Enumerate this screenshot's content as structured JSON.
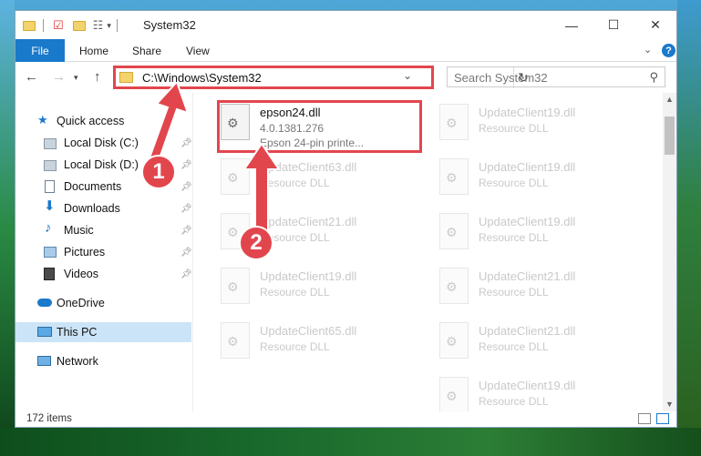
{
  "window": {
    "title": "System32",
    "controls": {
      "minimize": "—",
      "maximize": "☐",
      "close": "✕"
    }
  },
  "ribbon": {
    "tabs": [
      "File",
      "Home",
      "Share",
      "View"
    ],
    "help": "?"
  },
  "address": {
    "path": "C:\\Windows\\System32",
    "search_placeholder": "Search System32"
  },
  "sidebar": {
    "quick_access": "Quick access",
    "items": [
      {
        "label": "Local Disk (C:)",
        "icon": "drive-icon",
        "pinned": true
      },
      {
        "label": "Local Disk (D:)",
        "icon": "drive-icon",
        "pinned": true
      },
      {
        "label": "Documents",
        "icon": "documents-icon",
        "pinned": true
      },
      {
        "label": "Downloads",
        "icon": "downloads-icon",
        "pinned": true
      },
      {
        "label": "Music",
        "icon": "music-icon",
        "pinned": true
      },
      {
        "label": "Pictures",
        "icon": "pictures-icon",
        "pinned": true
      },
      {
        "label": "Videos",
        "icon": "videos-icon",
        "pinned": true
      }
    ],
    "onedrive": "OneDrive",
    "this_pc": "This PC",
    "network": "Network"
  },
  "files": [
    {
      "name": "epson24.dll",
      "version": "4.0.1381.276",
      "desc": "Epson 24-pin printe...",
      "highlight": true
    },
    {
      "name": "UpdateClient19.dll",
      "version": "Resource DLL",
      "desc": ""
    },
    {
      "name": "UpdateClient19.dll",
      "version": "Resource DLL",
      "desc": ""
    },
    {
      "name": "UpdateClient63.dll",
      "version": "Resource DLL",
      "desc": ""
    },
    {
      "name": "UpdateClient19.dll",
      "version": "Resource DLL",
      "desc": ""
    },
    {
      "name": "UpdateClient21.dll",
      "version": "Resource DLL",
      "desc": ""
    },
    {
      "name": "UpdateClient21.dll",
      "version": "Resource DLL",
      "desc": ""
    },
    {
      "name": "UpdateClient19.dll",
      "version": "Resource DLL",
      "desc": ""
    },
    {
      "name": "UpdateClient21.dll",
      "version": "Resource DLL",
      "desc": ""
    },
    {
      "name": "UpdateClient65.dll",
      "version": "Resource DLL",
      "desc": ""
    },
    {
      "name": "UpdateClient19.dll",
      "version": "Resource DLL",
      "desc": ""
    }
  ],
  "status": {
    "items": "172 items"
  },
  "annotations": {
    "badge1": "1",
    "badge2": "2"
  },
  "colors": {
    "accent": "#1979ca",
    "highlight": "#e2464d",
    "selected": "#cce4f7"
  }
}
